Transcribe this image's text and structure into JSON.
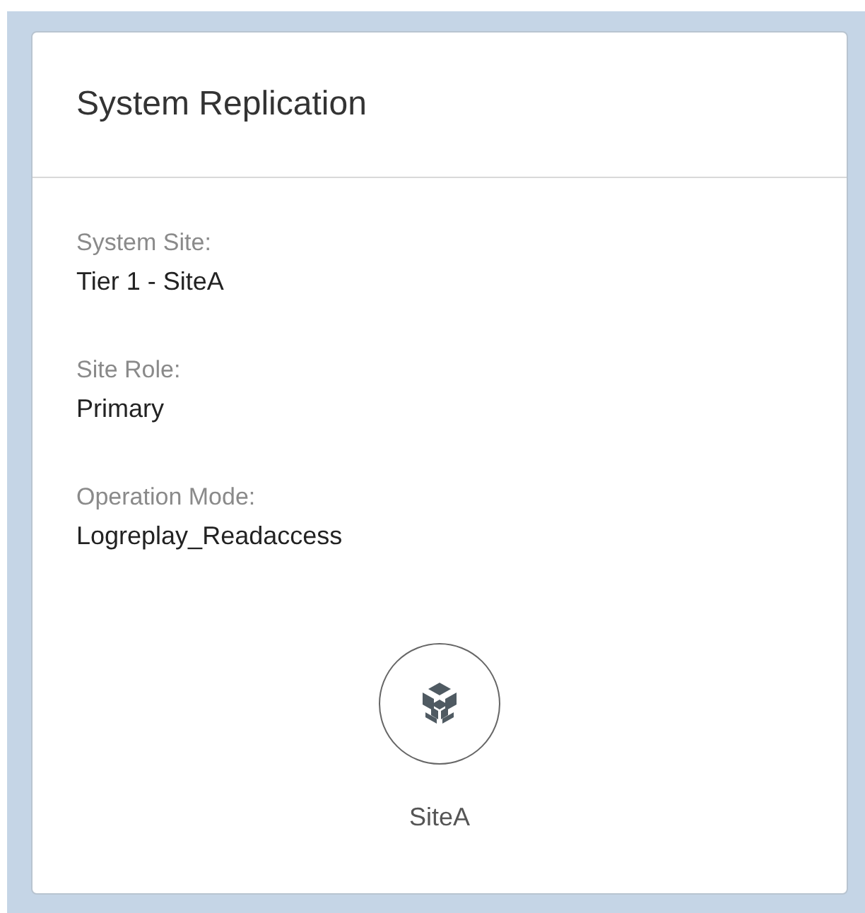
{
  "card": {
    "title": "System Replication",
    "fields": [
      {
        "label": "System Site:",
        "value": "Tier 1 - SiteA"
      },
      {
        "label": "Site Role:",
        "value": "Primary"
      },
      {
        "label": "Operation Mode:",
        "value": "Logreplay_Readaccess"
      }
    ],
    "site": {
      "name": "SiteA"
    }
  }
}
